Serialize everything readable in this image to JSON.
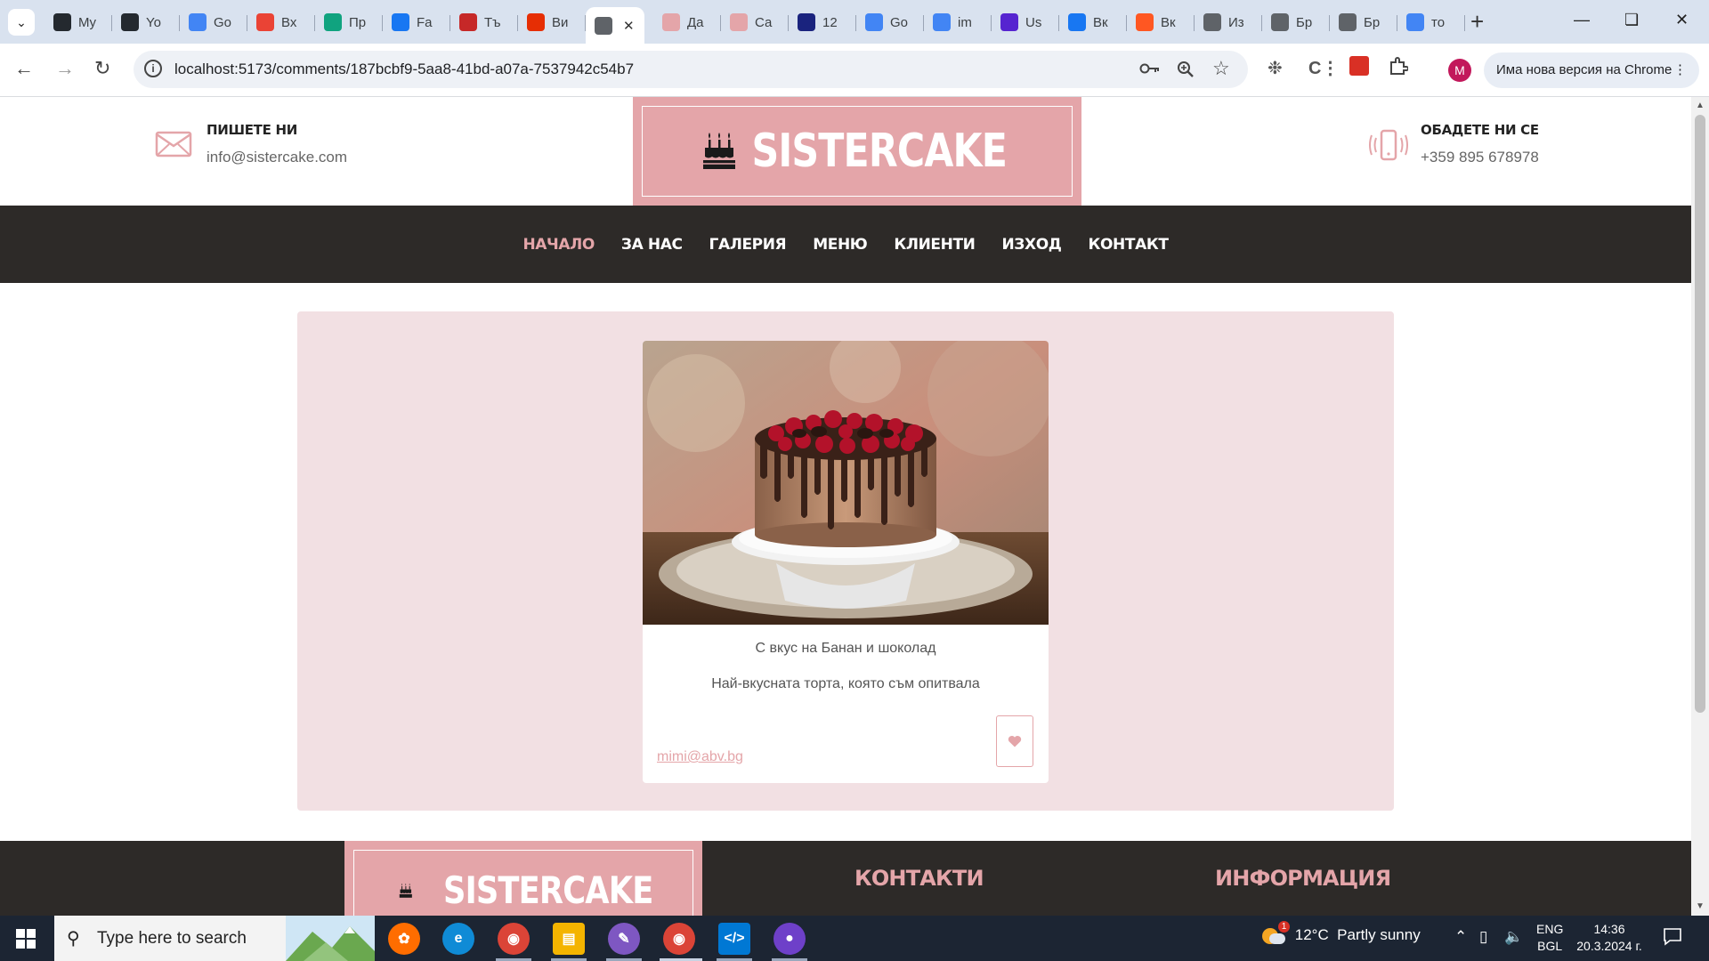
{
  "browser": {
    "tabs": [
      {
        "icon": "github-icon",
        "title": "My",
        "color": "#24292f"
      },
      {
        "icon": "github-icon",
        "title": "Yo",
        "color": "#24292f"
      },
      {
        "icon": "google-translate-icon",
        "title": "Go",
        "color": "#4285f4"
      },
      {
        "icon": "gmail-icon",
        "title": "Вх",
        "color": "#ea4335"
      },
      {
        "icon": "chatgpt-icon",
        "title": "Пр",
        "color": "#10a37f"
      },
      {
        "icon": "facebook-icon",
        "title": "Fa",
        "color": "#1877f2"
      },
      {
        "icon": "stripes-icon",
        "title": "Тъ",
        "color": "#c62828"
      },
      {
        "icon": "aliexpress-icon",
        "title": "Ви",
        "color": "#e62e04"
      },
      {
        "icon": "globe-icon",
        "title": "",
        "color": "#5f6368",
        "active": true
      },
      {
        "icon": "bag-icon",
        "title": "Да",
        "color": "#e4a5a9"
      },
      {
        "icon": "bag-icon",
        "title": "Са",
        "color": "#e4a5a9"
      },
      {
        "icon": "dev-icon",
        "title": "12",
        "color": "#1a237e"
      },
      {
        "icon": "google-translate-icon",
        "title": "Go",
        "color": "#4285f4"
      },
      {
        "icon": "google-icon",
        "title": "im",
        "color": "#4285f4"
      },
      {
        "icon": "udemy-icon",
        "title": "Us",
        "color": "#5624d0"
      },
      {
        "icon": "facebook-icon",
        "title": "Вк",
        "color": "#1877f2"
      },
      {
        "icon": "blogger-icon",
        "title": "Вк",
        "color": "#ff5722"
      },
      {
        "icon": "download-icon",
        "title": "Из",
        "color": "#5f6368"
      },
      {
        "icon": "download-icon",
        "title": "Бр",
        "color": "#5f6368"
      },
      {
        "icon": "download-icon",
        "title": "Бр",
        "color": "#5f6368"
      },
      {
        "icon": "google-icon",
        "title": "то",
        "color": "#4285f4"
      }
    ],
    "url": "localhost:5173/comments/187bcbf9-5aa8-41bd-a07a-7537942c54b7",
    "profile_initial": "M",
    "update_text": "Има нова версия на Chrome"
  },
  "site": {
    "brand": "SISTERCAKE",
    "accent_color": "#e4a5a9",
    "dark_color": "#2d2a28",
    "email": {
      "title": "ПИШЕТЕ НИ",
      "value": "info@sistercake.com"
    },
    "phone": {
      "title": "ОБАДЕТЕ НИ СЕ",
      "value": "+359 895 678978"
    },
    "nav": [
      {
        "label": "НАЧАЛО",
        "active": true
      },
      {
        "label": "ЗА НАС"
      },
      {
        "label": "ГАЛЕРИЯ"
      },
      {
        "label": "МЕНЮ"
      },
      {
        "label": "КЛИЕНТИ"
      },
      {
        "label": "ИЗХОД"
      },
      {
        "label": "КОНТАКТ"
      }
    ],
    "comment": {
      "title": "С вкус на Банан и шоколад",
      "text": "Най-вкусната торта, която съм опитвала",
      "author": "mimi@abv.bg"
    },
    "footer": {
      "brand": "SISTERCAKE",
      "contacts_heading": "КОНТАКТИ",
      "info_heading": "ИНФОРМАЦИЯ"
    }
  },
  "taskbar": {
    "search_placeholder": "Type here to search",
    "weather": "12°C  Partly sunny",
    "weather_badge": "1",
    "lang_top": "ENG",
    "lang_bottom": "BGL",
    "time": "14:36",
    "date": "20.3.2024 г."
  }
}
